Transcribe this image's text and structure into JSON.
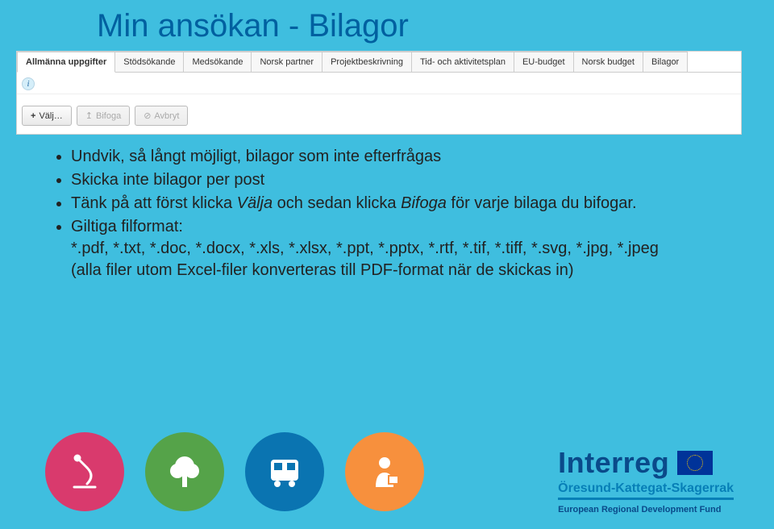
{
  "title": "Min ansökan - Bilagor",
  "tabs": [
    {
      "label": "Allmänna uppgifter",
      "active": true
    },
    {
      "label": "Stödsökande"
    },
    {
      "label": "Medsökande"
    },
    {
      "label": "Norsk partner"
    },
    {
      "label": "Projektbeskrivning"
    },
    {
      "label": "Tid- och aktivitetsplan"
    },
    {
      "label": "EU-budget"
    },
    {
      "label": "Norsk budget"
    },
    {
      "label": "Bilagor"
    }
  ],
  "buttons": {
    "select": "Välj…",
    "attach": "Bifoga",
    "cancel": "Avbryt"
  },
  "bullets": {
    "l1": "Undvik, så långt möjligt, bilagor som inte efterfrågas",
    "l2": "Skicka inte bilagor per post",
    "l3_a": "Tänk på att först klicka ",
    "l3_b": "Välja",
    "l3_c": " och sedan klicka ",
    "l3_d": "Bifoga",
    "l3_e": " för varje bilaga du bifogar.",
    "l4": "Giltiga filformat:",
    "l4_sub": "*.pdf, *.txt, *.doc, *.docx, *.xls, *.xlsx, *.ppt, *.pptx, *.rtf, *.tif, *.tiff, *.svg, *.jpg, *.jpeg",
    "l4_note": "(alla filer utom Excel-filer konverteras till PDF-format när de skickas in)"
  },
  "logo": {
    "brand": "Interreg",
    "region": "Öresund-Kattegat-Skagerrak",
    "fund": "European Regional Development Fund"
  }
}
